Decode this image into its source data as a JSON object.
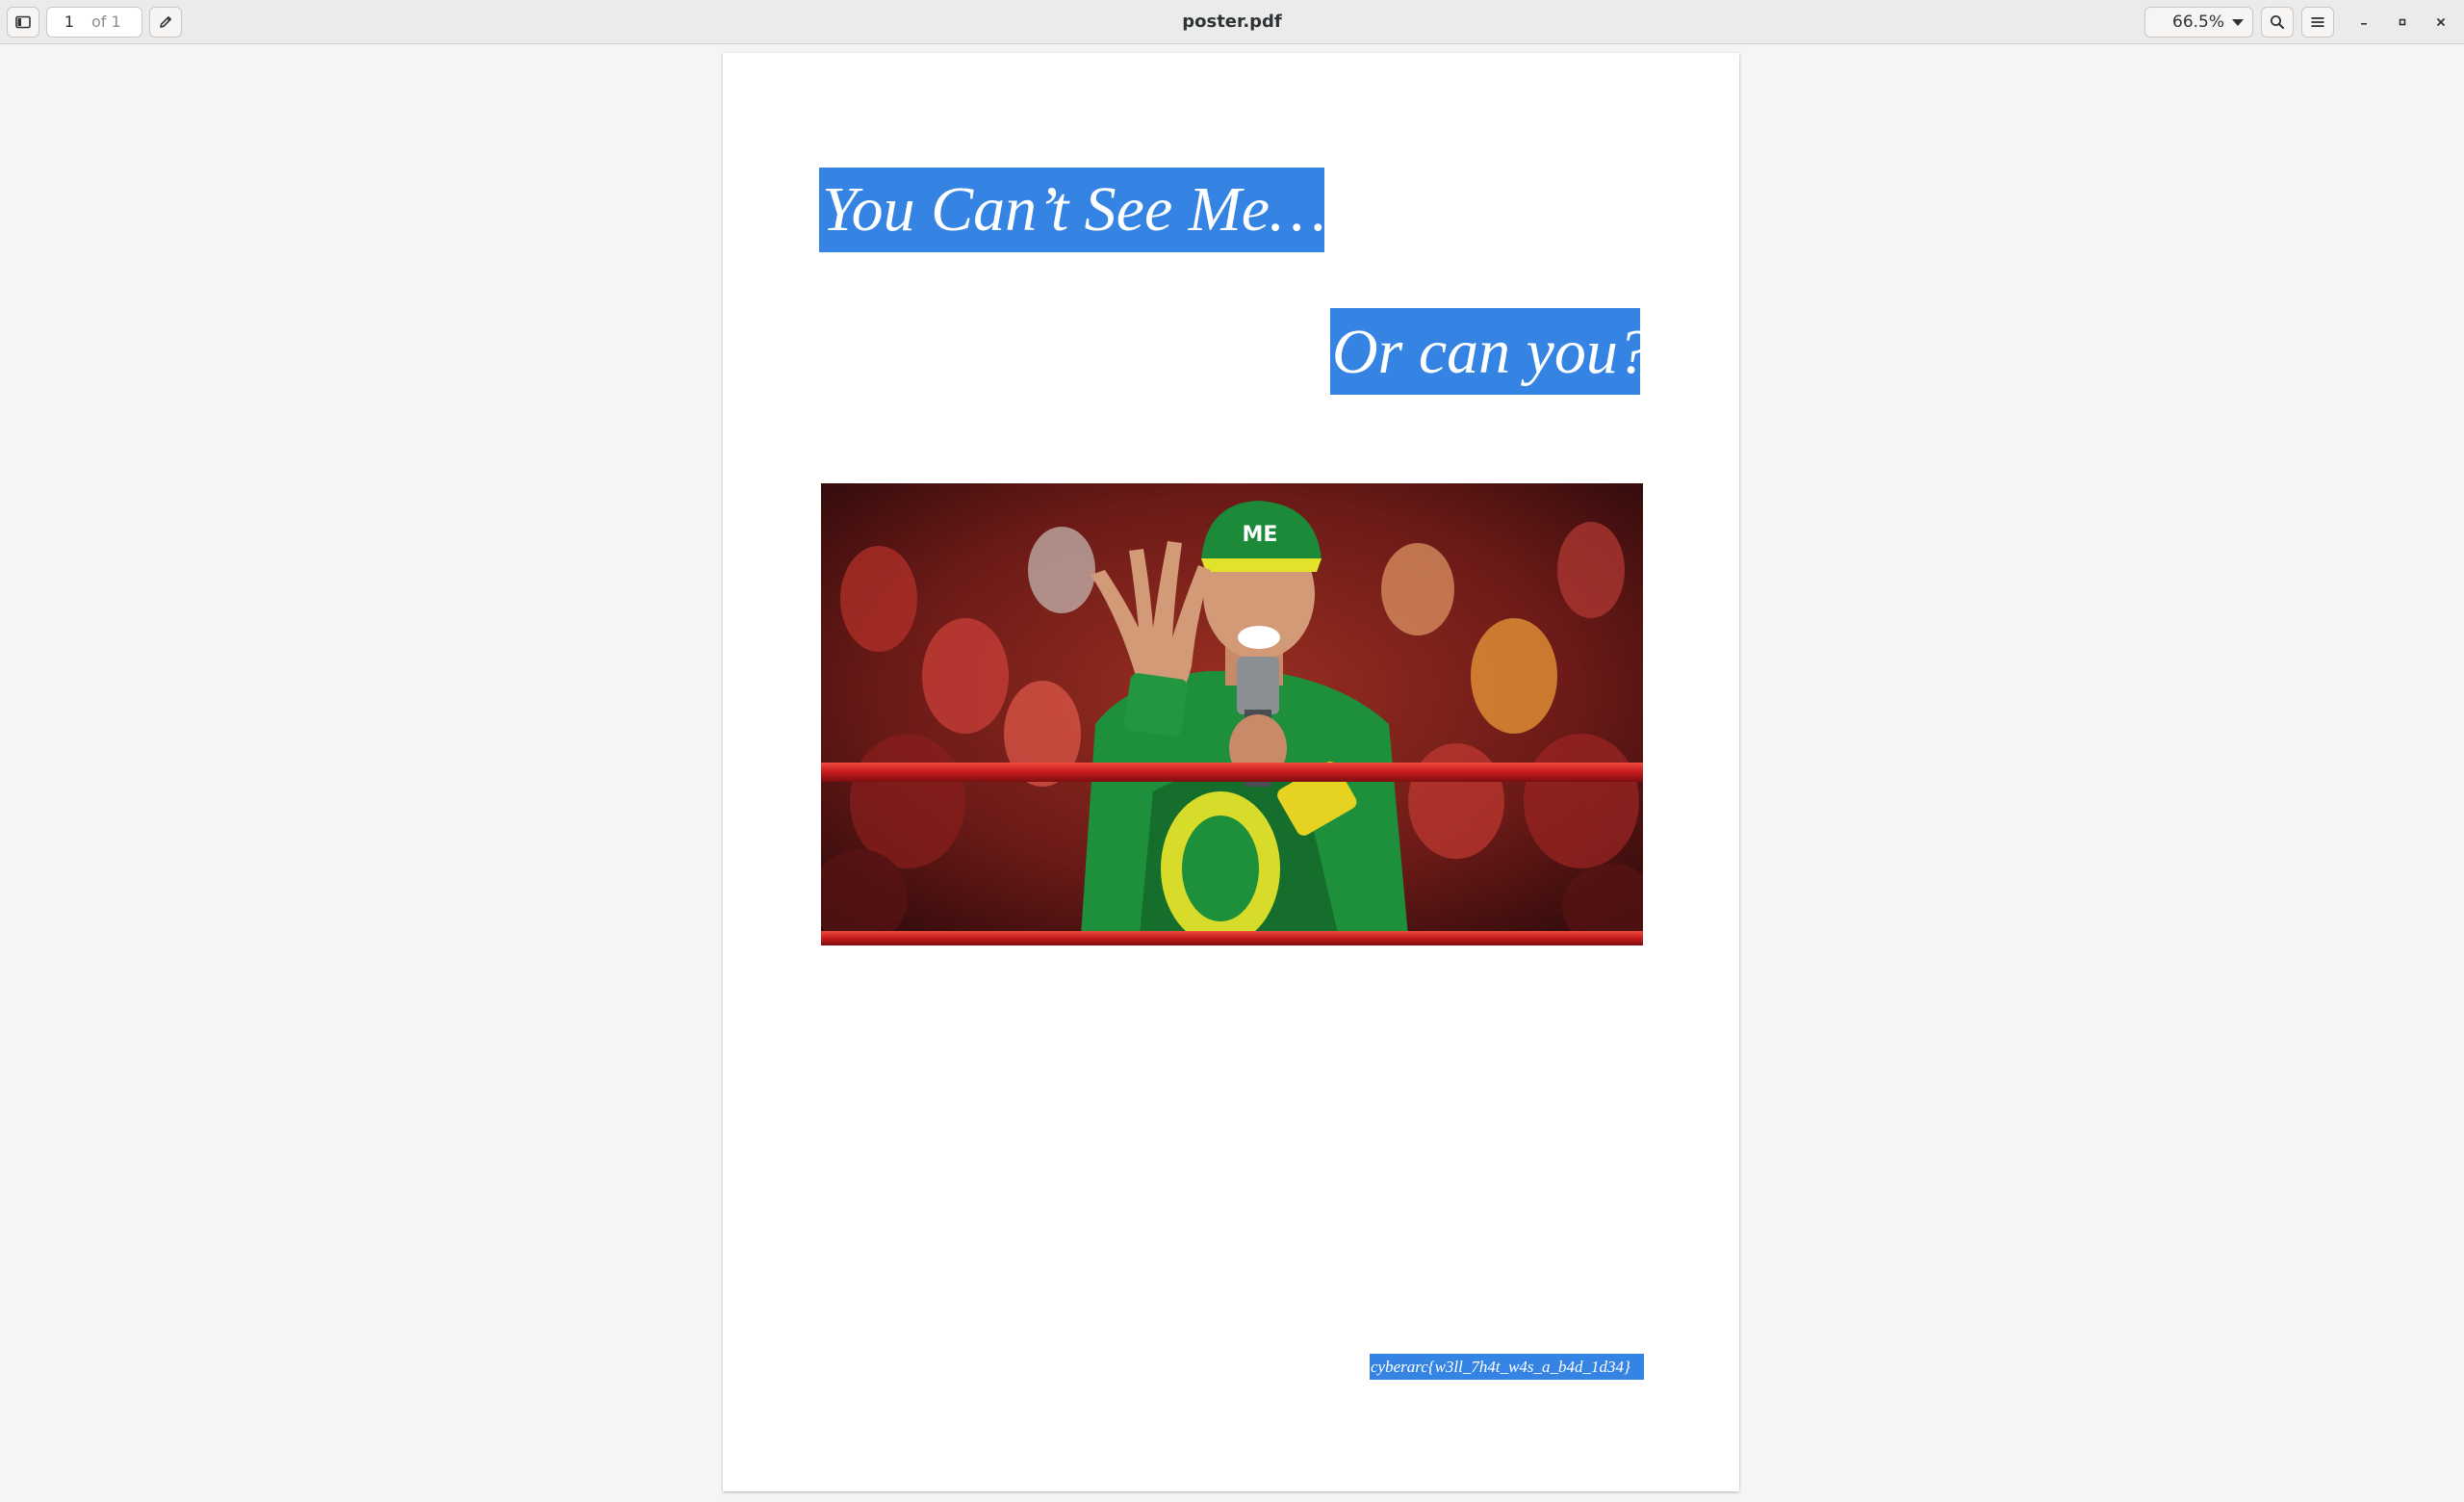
{
  "header": {
    "page_number": "1",
    "page_count_label": "of 1",
    "title": "poster.pdf",
    "zoom_level": "66.5%"
  },
  "icons": {
    "sidebar": "sidebar-toggle-icon",
    "annotate": "pencil-icon",
    "zoom_dropdown": "chevron-down-icon",
    "search": "search-icon",
    "menu": "hamburger-menu-icon",
    "minimize": "minimize-icon",
    "maximize": "maximize-icon",
    "close": "close-icon"
  },
  "document": {
    "line1": "You Can’t See Me….",
    "line2": "Or can you?",
    "hidden_text": "cyberarc{w3ll_7h4t_w4s_a_b4d_1d34}",
    "selection_color": "#3584e4"
  }
}
